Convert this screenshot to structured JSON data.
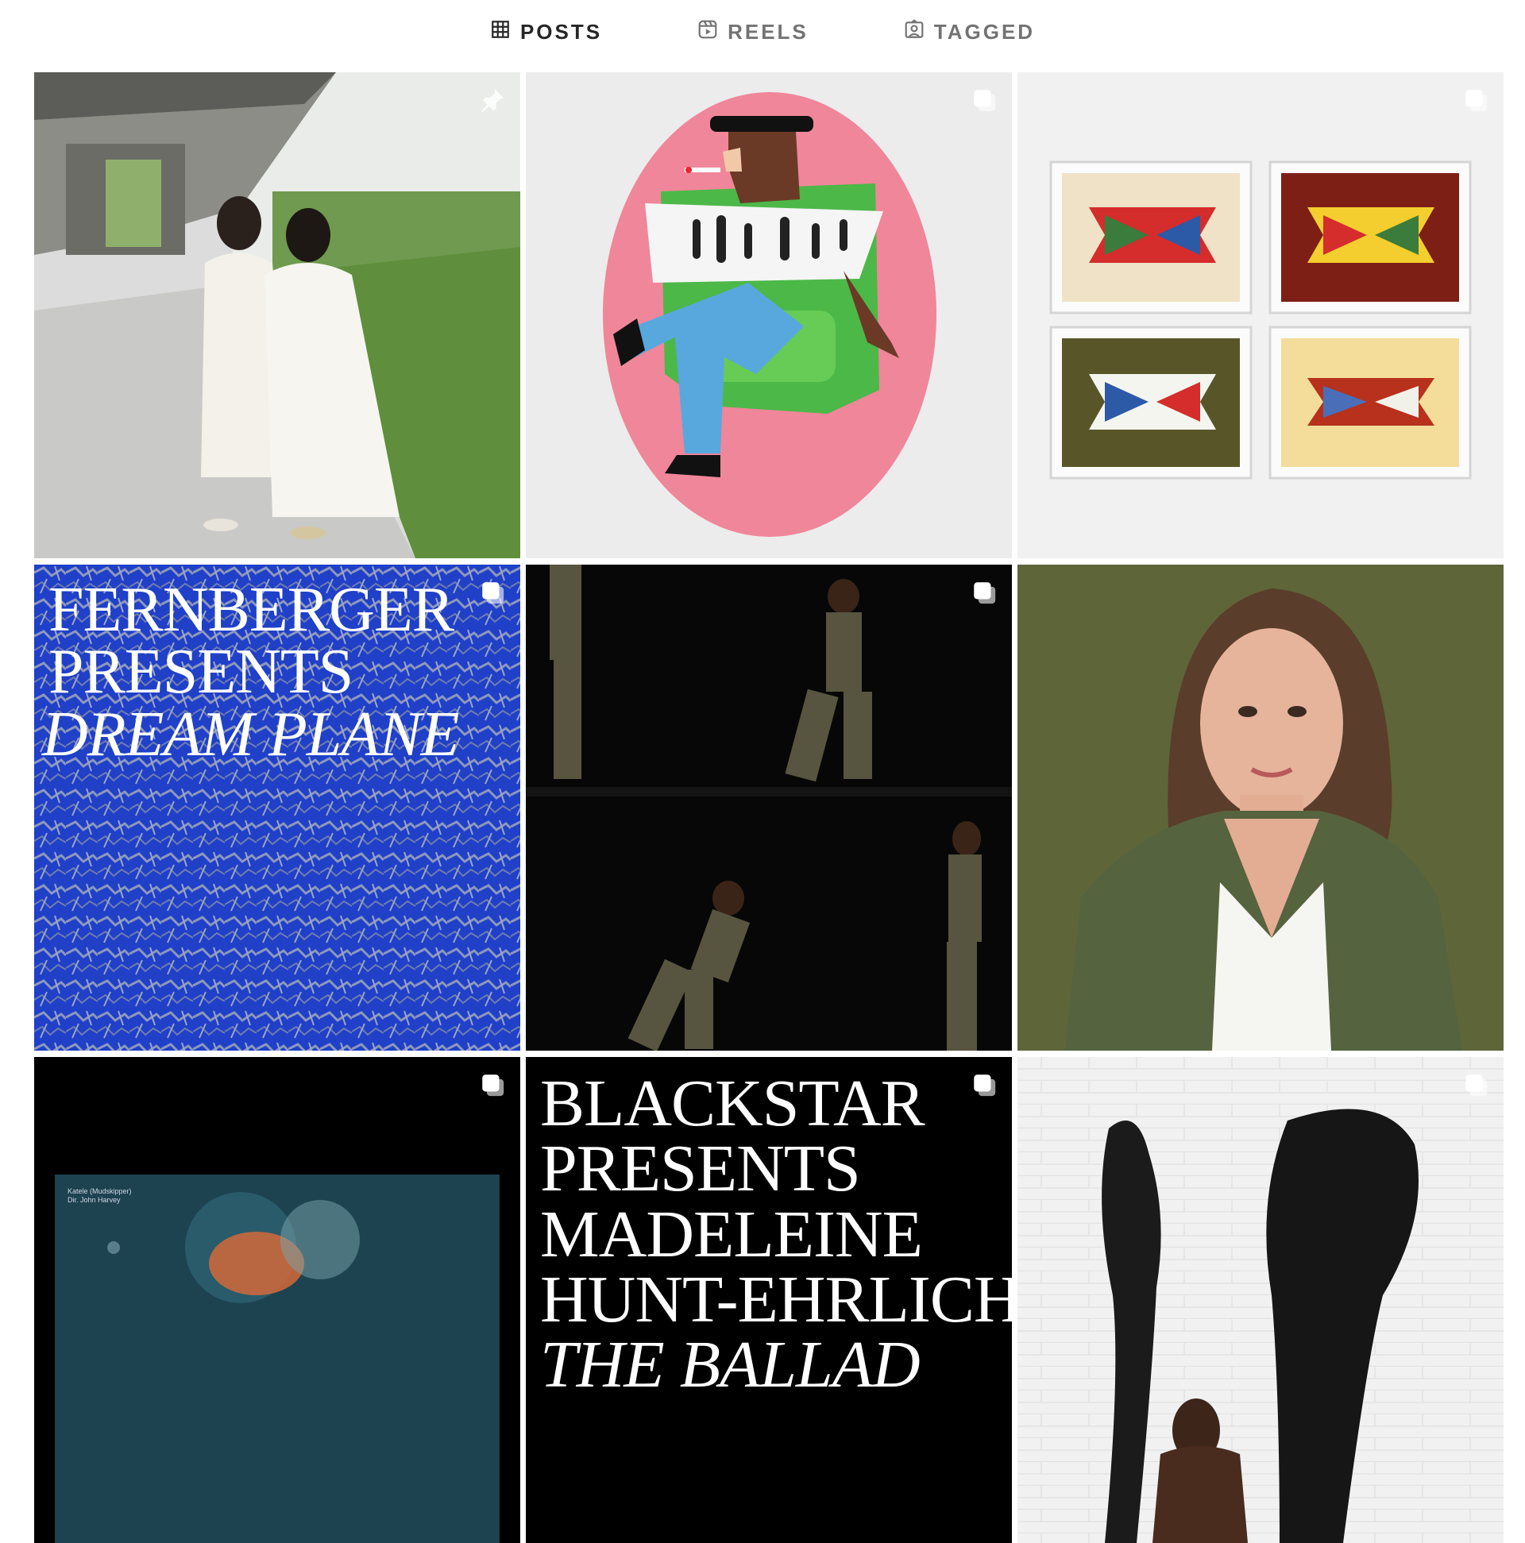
{
  "tabs": [
    {
      "label": "POSTS",
      "icon": "grid-icon",
      "active": true
    },
    {
      "label": "REELS",
      "icon": "reels-icon",
      "active": false
    },
    {
      "label": "TAGGED",
      "icon": "tagged-icon",
      "active": false
    }
  ],
  "posts": [
    {
      "badge": "pin-icon"
    },
    {
      "badge": "carousel-icon"
    },
    {
      "badge": "carousel-icon"
    },
    {
      "badge": "carousel-icon",
      "text": {
        "line1": "FERNBERGER",
        "line2": "PRESENTS",
        "line3": "DREAM PLANE"
      }
    },
    {
      "badge": "carousel-icon"
    },
    {
      "badge": null
    },
    {
      "badge": "carousel-icon",
      "caption": {
        "line1": "Katele (Mudskipper)",
        "line2": "Dir. John Harvey"
      }
    },
    {
      "badge": "carousel-icon",
      "text": {
        "line1": "BLACKSTAR",
        "line2": "PRESENTS",
        "line3": "MADELEINE",
        "line4": "HUNT-EHRLICH,",
        "line5": "THE BALLAD"
      }
    },
    {
      "badge": "carousel-icon"
    }
  ],
  "colors": {
    "active_tab": "#262626",
    "inactive_tab": "#737373",
    "blue_texture": "#1f3fcf",
    "pink_oval": "#f0869a"
  }
}
